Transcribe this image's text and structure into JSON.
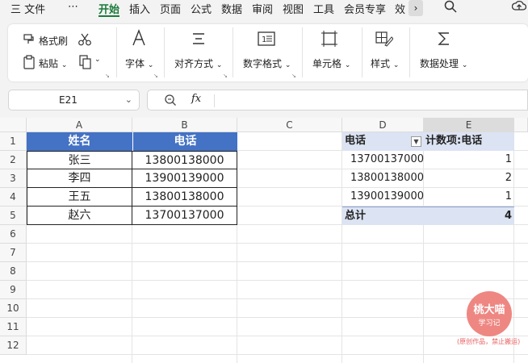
{
  "menubar": {
    "hamburger": "三 文件",
    "more": "⋯",
    "tabs": [
      "开始",
      "插入",
      "页面",
      "公式",
      "数据",
      "审阅",
      "视图",
      "工具",
      "会员专享",
      "效"
    ],
    "chevron": "›",
    "search_icon": "search-icon",
    "upload_icon": "cloud-upload-icon"
  },
  "ribbon": {
    "format_painter": "格式刷",
    "paste": "粘贴",
    "font": "字体",
    "align": "对齐方式",
    "number_format": "数字格式",
    "cell": "单元格",
    "style": "样式",
    "data_process": "数据处理"
  },
  "formula_bar": {
    "cell_ref": "E21",
    "fx": "fx",
    "formula": ""
  },
  "grid": {
    "columns": [
      "A",
      "B",
      "C",
      "D",
      "E"
    ],
    "rows": [
      "1",
      "2",
      "3",
      "4",
      "5",
      "6",
      "7",
      "8",
      "9",
      "10",
      "11",
      "12"
    ]
  },
  "source_table": {
    "headers": [
      "姓名",
      "电话"
    ],
    "rows": [
      [
        "张三",
        "13800138000"
      ],
      [
        "李四",
        "13900139000"
      ],
      [
        "王五",
        "13800138000"
      ],
      [
        "赵六",
        "13700137000"
      ]
    ],
    "header_color": "#4472c4"
  },
  "pivot_table": {
    "row_header": "电话",
    "value_header": "计数项:电话",
    "rows": [
      [
        "13700137000",
        "1"
      ],
      [
        "13800138000",
        "2"
      ],
      [
        "13900139000",
        "1"
      ]
    ],
    "total_label": "总计",
    "total_value": "4",
    "header_color": "#dce3f3"
  },
  "watermark": {
    "line1": "桃大喵",
    "line2": "学习记",
    "note": "(原创作品，禁止搬运)",
    "color": "#ee8782"
  }
}
